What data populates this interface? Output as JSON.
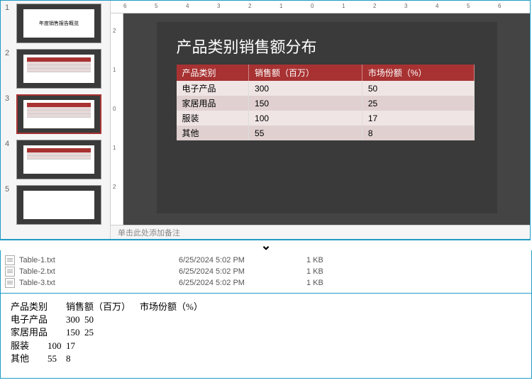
{
  "slide_title": "产品类别销售额分布",
  "notes_placeholder": "单击此处添加备注",
  "thumbs": [
    {
      "num": "1",
      "title": "年度销售报告概览"
    },
    {
      "num": "2"
    },
    {
      "num": "3"
    },
    {
      "num": "4"
    },
    {
      "num": "5"
    }
  ],
  "table": {
    "headers": [
      "产品类别",
      "销售额（百万）",
      "市场份额（%）"
    ],
    "rows": [
      [
        "电子产品",
        "300",
        "50"
      ],
      [
        "家居用品",
        "150",
        "25"
      ],
      [
        "服装",
        "100",
        "17"
      ],
      [
        "其他",
        "55",
        "8"
      ]
    ]
  },
  "files": [
    {
      "name": "Table-1.txt",
      "date": "6/25/2024 5:02 PM",
      "size": "1 KB"
    },
    {
      "name": "Table-2.txt",
      "date": "6/25/2024 5:02 PM",
      "size": "1 KB"
    },
    {
      "name": "Table-3.txt",
      "date": "6/25/2024 5:02 PM",
      "size": "1 KB"
    }
  ],
  "raw_text": "产品类别\t销售额（百万）\t市场份额（%）\n电子产品\t300\t50\n家居用品\t150\t25\n服装\t100\t17\n其他\t55\t8",
  "ruler_h": [
    "0",
    "1",
    "2",
    "3",
    "4",
    "5",
    "6"
  ],
  "ruler_v": [
    "0",
    "1",
    "2"
  ],
  "chart_data": {
    "type": "table",
    "title": "产品类别销售额分布",
    "headers": [
      "产品类别",
      "销售额（百万）",
      "市场份额（%）"
    ],
    "rows": [
      {
        "category": "电子产品",
        "sales_million": 300,
        "share_pct": 50
      },
      {
        "category": "家居用品",
        "sales_million": 150,
        "share_pct": 25
      },
      {
        "category": "服装",
        "sales_million": 100,
        "share_pct": 17
      },
      {
        "category": "其他",
        "sales_million": 55,
        "share_pct": 8
      }
    ]
  }
}
